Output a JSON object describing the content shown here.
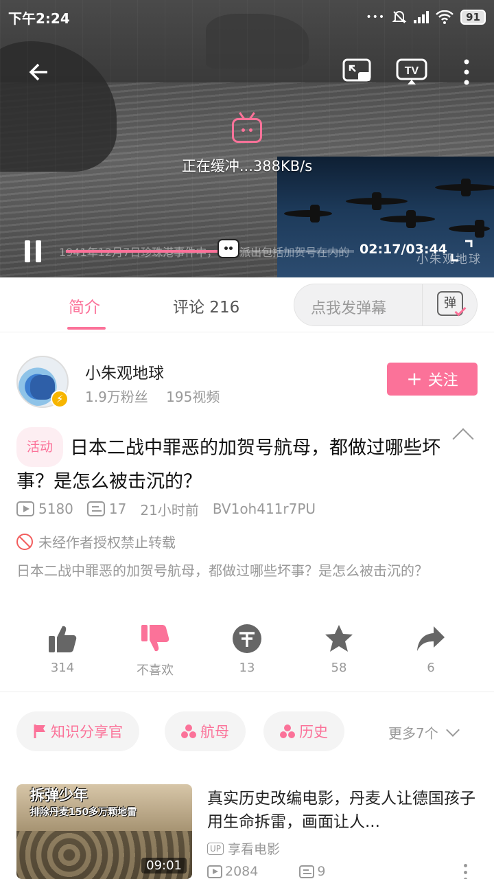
{
  "status_bar": {
    "time": "下午2:24",
    "battery": "91"
  },
  "player": {
    "buffer_text": "正在缓冲...388KB/s",
    "subtitle": "1941年12月7日珍珠港事件中，日本派出包括加贺号在内的",
    "timecode": "02:17/03:44",
    "progress": 0.565,
    "pip_watermark": "小朱观地球"
  },
  "tabs": {
    "intro": "简介",
    "comments": "评论 216",
    "danmaku_placeholder": "点我发弹幕",
    "danmaku_icon": "弹"
  },
  "uploader": {
    "name": "小朱观地球",
    "fans": "1.9万粉丝",
    "videos": "195视频",
    "follow_label": "关注"
  },
  "video": {
    "activity_tag": "活动",
    "title": "日本二战中罪恶的加贺号航母，都做过哪些坏事？是怎么被击沉的？",
    "views": "5180",
    "danmaku_count": "17",
    "time_ago": "21小时前",
    "bvid": "BV1oh411r7PU",
    "copyright": "未经作者授权禁止转载",
    "description": "日本二战中罪恶的加贺号航母，都做过哪些坏事？是怎么被击沉的？"
  },
  "actions": {
    "like": "314",
    "dislike": "不喜欢",
    "coin": "13",
    "favorite": "58",
    "share": "6"
  },
  "tags": {
    "items": [
      "知识分享官",
      "航母",
      "历史"
    ],
    "more": "更多7个"
  },
  "related": {
    "thumb_title": "拆弹少年",
    "thumb_subtitle": "排除丹麦150多万颗地雷",
    "duration": "09:01",
    "title": "真实历史改编电影，丹麦人让德国孩子用生命拆雷，画面让人...",
    "up_badge": "UP",
    "uploader": "享看电影",
    "views": "2084",
    "danmaku": "9"
  },
  "colors": {
    "accent": "#fb7299",
    "muted": "#999999"
  }
}
